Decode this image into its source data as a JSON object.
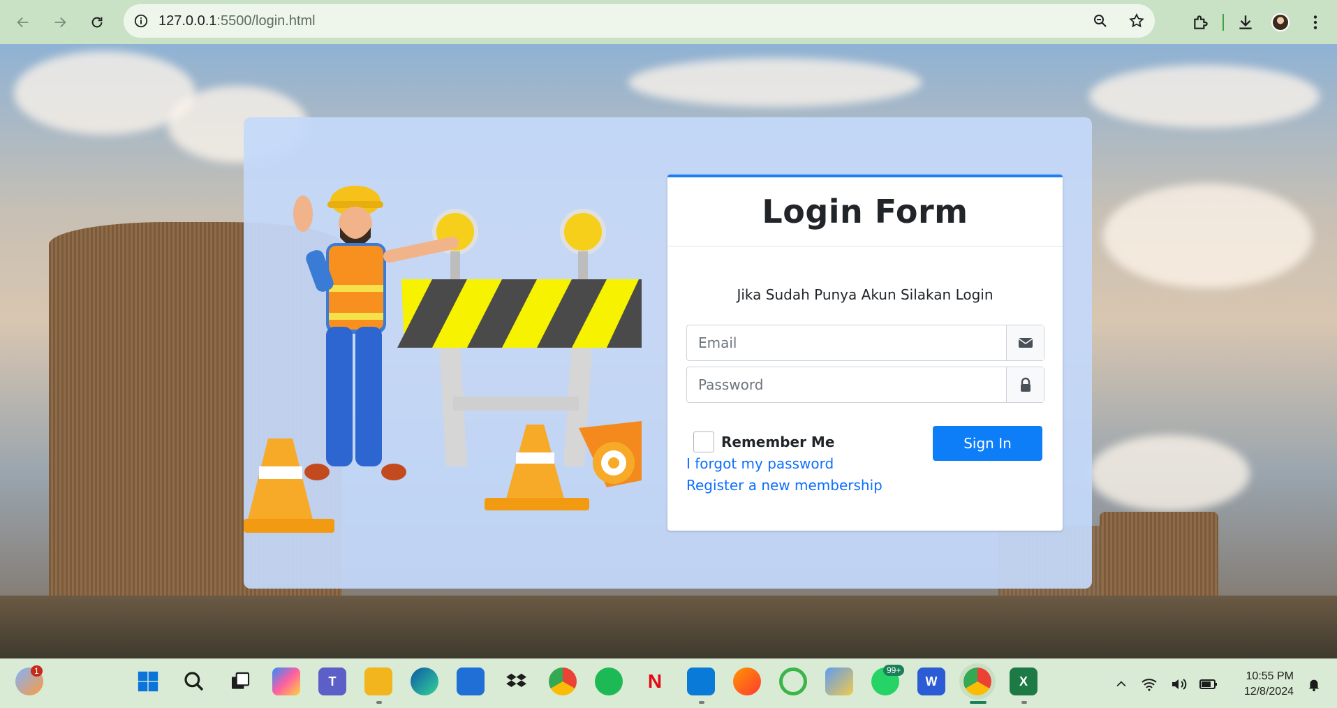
{
  "browser": {
    "url_host": "127.0.0.1",
    "url_rest": ":5500/login.html"
  },
  "login": {
    "title": "Login Form",
    "subtitle": "Jika Sudah Punya Akun Silakan Login",
    "email_placeholder": "Email",
    "password_placeholder": "Password",
    "remember_label": "Remember Me",
    "signin_label": "Sign In",
    "forgot_link": "I forgot my password",
    "register_link": "Register a new membership"
  },
  "taskbar": {
    "weather_badge": "1",
    "whatsapp_badge": "99+",
    "time": "10:55 PM",
    "date": "12/8/2024"
  },
  "colors": {
    "accent": "#0d7ef7",
    "card": "#c4d8fa",
    "chrome": "#c9e2c5"
  }
}
